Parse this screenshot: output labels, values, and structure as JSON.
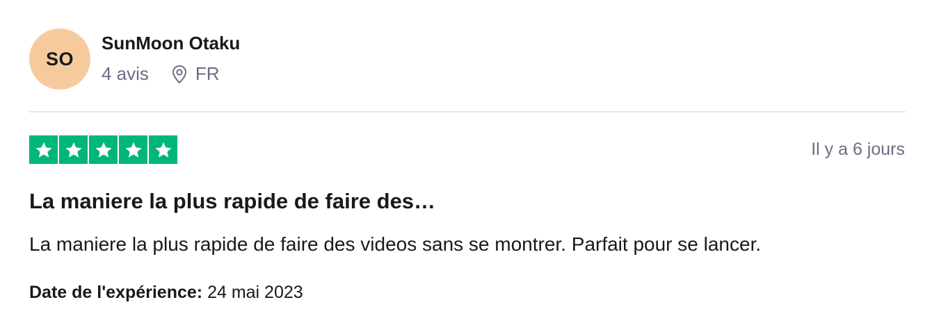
{
  "reviewer": {
    "initials": "SO",
    "name": "SunMoon Otaku",
    "review_count": "4 avis",
    "country": "FR",
    "avatar_color": "#f7ca9e"
  },
  "review": {
    "rating": 5,
    "max_rating": 5,
    "star_color": "#00b67a",
    "posted": "Il y a 6 jours",
    "title": "La maniere la plus rapide de faire des…",
    "body": "La maniere la plus rapide de faire des videos sans se montrer. Parfait pour se lancer.",
    "experience_label": "Date de l'expérience:",
    "experience_date": "24 mai 2023"
  },
  "icons": {
    "location": "location-pin-icon",
    "star": "star-icon"
  }
}
